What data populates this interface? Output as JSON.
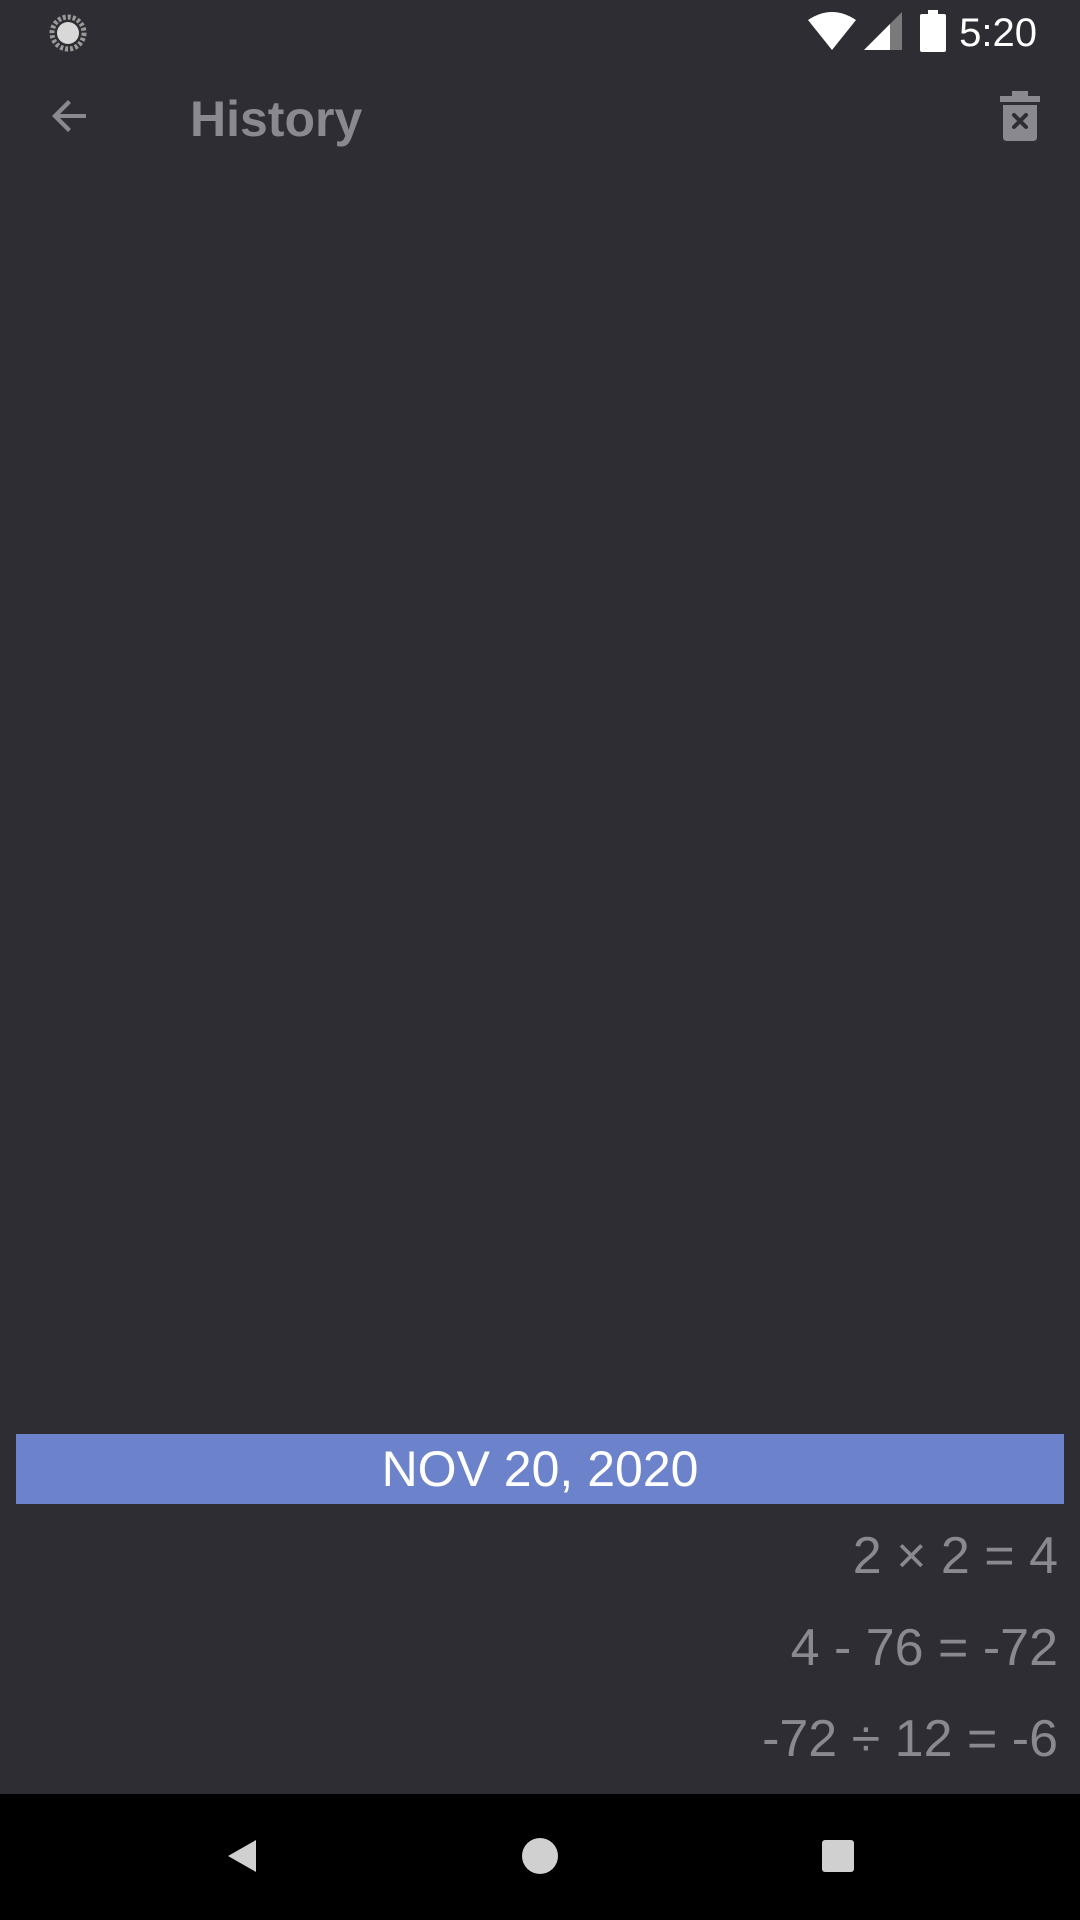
{
  "status_bar": {
    "time": "5:20",
    "icons": [
      "loading-icon",
      "wifi-icon",
      "signal-icon",
      "battery-icon"
    ]
  },
  "app_bar": {
    "title": "History",
    "back_icon": "arrow-back-icon",
    "delete_icon": "delete-history-icon"
  },
  "history": {
    "date": "NOV 20, 2020",
    "items": [
      "2 × 2 = 4",
      "4 - 76 = -72",
      "-72 ÷ 12 = -6"
    ]
  },
  "nav_bar": {
    "icons": [
      "back-triangle-icon",
      "home-circle-icon",
      "recents-square-icon"
    ]
  },
  "colors": {
    "background": "#2e2d33",
    "accent": "#6c82cb",
    "muted_text": "#8a898f",
    "nav_bar": "#000000"
  }
}
